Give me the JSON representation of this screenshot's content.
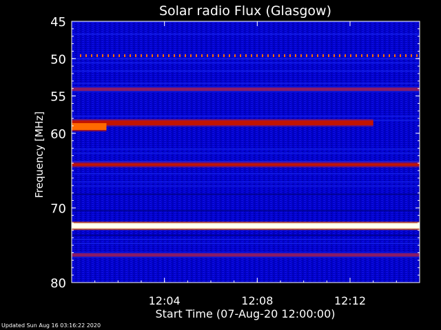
{
  "chart_data": {
    "type": "heatmap",
    "title": "Solar radio Flux (Glasgow)",
    "xlabel": "Start Time (07-Aug-20 12:00:00)",
    "ylabel": "Frequency [MHz]",
    "xlim": [
      "12:00:00",
      "12:15:00"
    ],
    "ylim": [
      45,
      80
    ],
    "y_ticks": [
      45,
      50,
      55,
      60,
      70,
      80
    ],
    "y_tick_labels": [
      "45",
      "50",
      "55",
      "60",
      "70",
      "80"
    ],
    "x_ticks": [
      "12:04",
      "12:08",
      "12:12"
    ],
    "colormap": [
      "#00007a",
      "#0a1ae0",
      "#8a1a66",
      "#c21400",
      "#ff6a00",
      "#ffd060",
      "#ffffe0"
    ],
    "background_level": "low (blue)",
    "bands": [
      {
        "freq_mhz": 49.6,
        "start": "12:00:00",
        "end": "12:15:00",
        "level": "periodic dotted emission"
      },
      {
        "freq_mhz": 54.1,
        "start": "12:00:00",
        "end": "12:15:00",
        "level": "weak"
      },
      {
        "freq_mhz": 58.6,
        "start": "12:00:00",
        "end": "12:13:00",
        "level": "strong (red/orange)"
      },
      {
        "freq_mhz": 59.1,
        "start": "12:00:00",
        "end": "12:01:30",
        "level": "very strong (orange/yellow)"
      },
      {
        "freq_mhz": 64.2,
        "start": "12:00:00",
        "end": "12:15:00",
        "level": "moderate (red)"
      },
      {
        "freq_mhz": 72.4,
        "start": "12:00:00",
        "end": "12:15:00",
        "level": "saturated (white/yellow)"
      },
      {
        "freq_mhz": 76.3,
        "start": "12:00:00",
        "end": "12:15:00",
        "level": "weak"
      }
    ]
  },
  "footer": {
    "updated": "Updated Sun Aug 16 03:16:22 2020"
  }
}
